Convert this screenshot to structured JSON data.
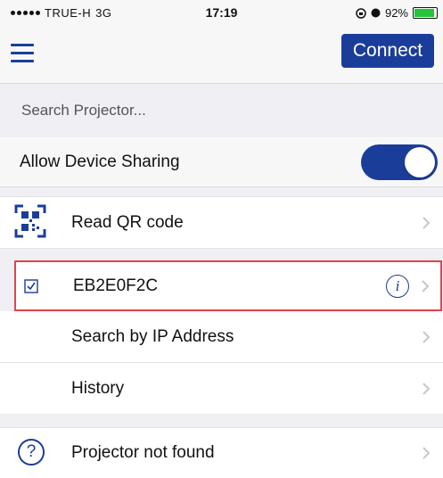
{
  "status_bar": {
    "carrier": "TRUE-H",
    "network": "3G",
    "time": "17:19",
    "battery": "92%",
    "battery_level": 0.92
  },
  "nav": {
    "menu_icon": "hamburger-menu-icon",
    "connect_label": "Connect"
  },
  "section": {
    "search_label": "Search Projector..."
  },
  "sharing": {
    "label": "Allow Device Sharing",
    "enabled": true
  },
  "rows": {
    "qr_label": "Read QR code",
    "device_label": "EB2E0F2C",
    "device_info_glyph": "i",
    "ip_label": "Search by IP Address",
    "history_label": "History",
    "not_found_label": "Projector not found",
    "help_glyph": "?"
  },
  "colors": {
    "accent": "#1b3d9a",
    "selection_border": "#e2434d",
    "battery": "#22c43a"
  }
}
